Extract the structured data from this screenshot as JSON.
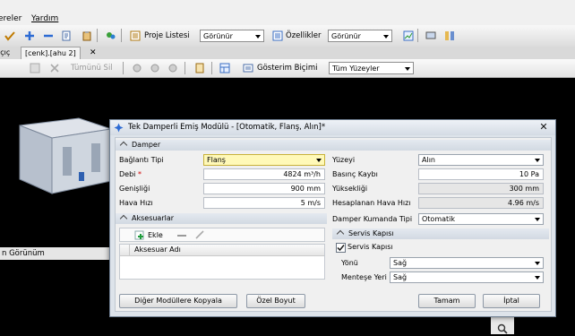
{
  "menu": {
    "items": [
      "ereler",
      "Yardım"
    ]
  },
  "toolbar1": {
    "project_list_label": "Proje Listesi",
    "project_list_value": "Görünür",
    "properties_label": "Özellikler",
    "properties_value": "Görünür"
  },
  "tabs": {
    "left_partial": "ıçıç",
    "active": "[cenk].[ahu 2]",
    "close": "✕"
  },
  "toolbar2": {
    "delete_all": "Tümünü Sil",
    "display_mode_label": "Gösterim Biçimi",
    "display_mode_value": "Tüm Yüzeyler"
  },
  "background": {
    "bottom_strip": "n Görünüm"
  },
  "dialog": {
    "title": "Tek Damperli Emiş Modülü - [Otomatik, Flanş, Alın]*",
    "damper": {
      "header": "Damper",
      "connection_type_label": "Bağlantı Tipi",
      "connection_type_value": "Flanş",
      "flow_label": "Debi",
      "flow_required": "*",
      "flow_value": "4824",
      "flow_unit": "m³/h",
      "width_label": "Genişliği",
      "width_value": "900",
      "width_unit": "mm",
      "air_speed_label": "Hava Hızı",
      "air_speed_value": "5",
      "air_speed_unit": "m/s",
      "surface_label": "Yüzeyi",
      "surface_value": "Alın",
      "pressure_drop_label": "Basınç Kaybı",
      "pressure_drop_value": "10",
      "pressure_drop_unit": "Pa",
      "height_label": "Yüksekliği",
      "height_value": "300",
      "height_unit": "mm",
      "calc_air_speed_label": "Hesaplanan Hava Hızı",
      "calc_air_speed_value": "4.96",
      "calc_air_speed_unit": "m/s",
      "control_type_label": "Damper Kumanda Tipi",
      "control_type_value": "Otomatik"
    },
    "accessories": {
      "header": "Aksesuarlar",
      "add_label": "Ekle",
      "column_name": "Aksesuar Adı"
    },
    "service_door": {
      "header": "Servis Kapısı",
      "checkbox_label": "Servis Kapısı",
      "checked": true,
      "direction_label": "Yönü",
      "direction_value": "Sağ",
      "hinge_label": "Menteşe Yeri",
      "hinge_value": "Sağ"
    },
    "buttons": {
      "copy": "Diğer Modüllere Kopyala",
      "custom_size": "Özel Boyut",
      "ok": "Tamam",
      "cancel": "İptal"
    }
  },
  "colors": {
    "highlight_field": "#fff9b8",
    "dialog_border": "#6f7f92",
    "accent_blue": "#2d6bd3"
  }
}
